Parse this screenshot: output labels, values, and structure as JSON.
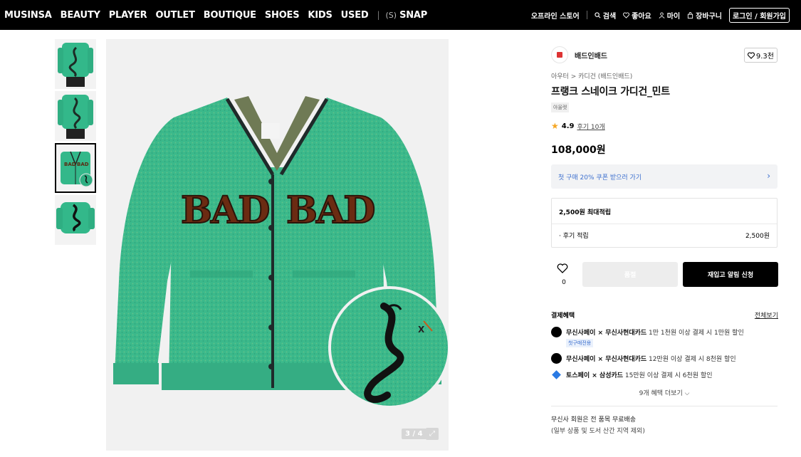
{
  "nav": {
    "items": [
      "MUSINSA",
      "BEAUTY",
      "PLAYER",
      "OUTLET",
      "BOUTIQUE",
      "SHOES",
      "KIDS",
      "USED"
    ],
    "separator": "|",
    "snap_prefix": "(S)",
    "snap_label": "SNAP",
    "right": {
      "offline": "오프라인 스토어",
      "search": "검색",
      "likes": "좋아요",
      "my": "마이",
      "cart": "장바구니",
      "login": "로그인 / 회원가입"
    }
  },
  "gallery": {
    "pager": "3 / 4",
    "selected_index": 3,
    "thumb_count": 4,
    "product_color": "#33b88a"
  },
  "product": {
    "brand": "배드인배드",
    "likes": "9.3천",
    "breadcrumb": "아우터 > 카디건 (배드인배드)",
    "title": "프랭크 스네이크 가디건_민트",
    "tag": "아울렛",
    "rating": "4.9",
    "reviews": "후기 10개",
    "price": "108,000원",
    "coupon": "첫 구매 20% 쿠폰 받으러 가기",
    "points_title": "2,500원 최대적립",
    "points_row_label": "· 후기 적립",
    "points_row_value": "2,500원",
    "wish_count": "0",
    "buy_label": "품절",
    "restock_label": "재입고 알림 신청"
  },
  "benefits": {
    "heading": "결제혜택",
    "all": "전체보기",
    "items": [
      {
        "bold": "무신사페이 × 무신사현대카드",
        "text": " 1만 1천원 이상 결제 시 1만원 할인",
        "sub": "첫구매전용"
      },
      {
        "bold": "무신사페이 × 무신사현대카드",
        "text": " 12만원 이상 결제 시 8천원 할인",
        "sub": ""
      },
      {
        "bold": "토스페이 × 삼성카드",
        "text": " 15만원 이상 결제 시 6천원 할인",
        "sub": ""
      }
    ],
    "more": "9개 혜택 더보기 ⌵"
  },
  "shipping": {
    "line1": "무신사 회원은 전 품목 무료배송",
    "line2": "(일부 상품 및 도서 산간 지역 제외)"
  }
}
